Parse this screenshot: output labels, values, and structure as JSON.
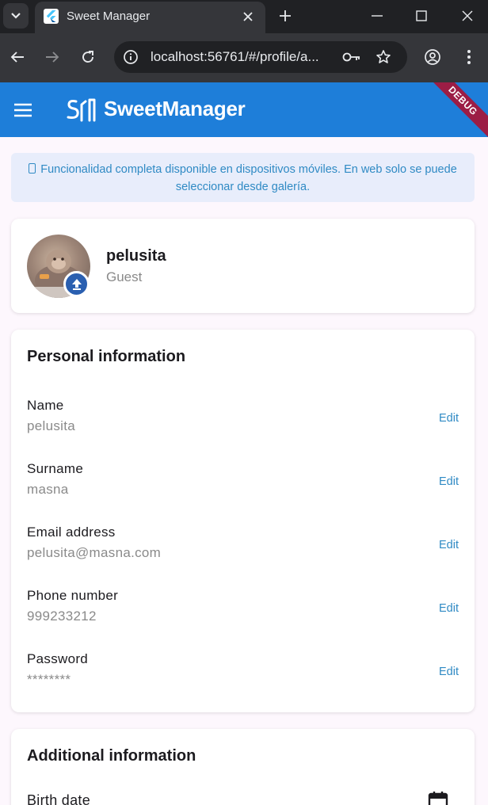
{
  "browser": {
    "tab_title": "Sweet Manager",
    "url": "localhost:56761/#/profile/a..."
  },
  "appbar": {
    "title": "SweetManager",
    "debug_label": "DEBUG",
    "color": "#1e7ed9"
  },
  "notice": {
    "text": "Funcionalidad completa disponible en dispositivos móviles. En web solo se puede seleccionar desde galería."
  },
  "profile": {
    "name": "pelusita",
    "role": "Guest"
  },
  "personal": {
    "title": "Personal information",
    "fields": [
      {
        "label": "Name",
        "value": "pelusita",
        "action": "Edit"
      },
      {
        "label": "Surname",
        "value": "masna",
        "action": "Edit"
      },
      {
        "label": "Email address",
        "value": "pelusita@masna.com",
        "action": "Edit"
      },
      {
        "label": "Phone number",
        "value": "999233212",
        "action": "Edit"
      },
      {
        "label": "Password",
        "value": "********",
        "action": "Edit"
      }
    ]
  },
  "additional": {
    "title": "Additional information",
    "birth_label": "Birth date"
  },
  "colors": {
    "accent": "#2f8ac4",
    "badge": "#2a5fb0",
    "ribbon": "#9c1d45"
  }
}
